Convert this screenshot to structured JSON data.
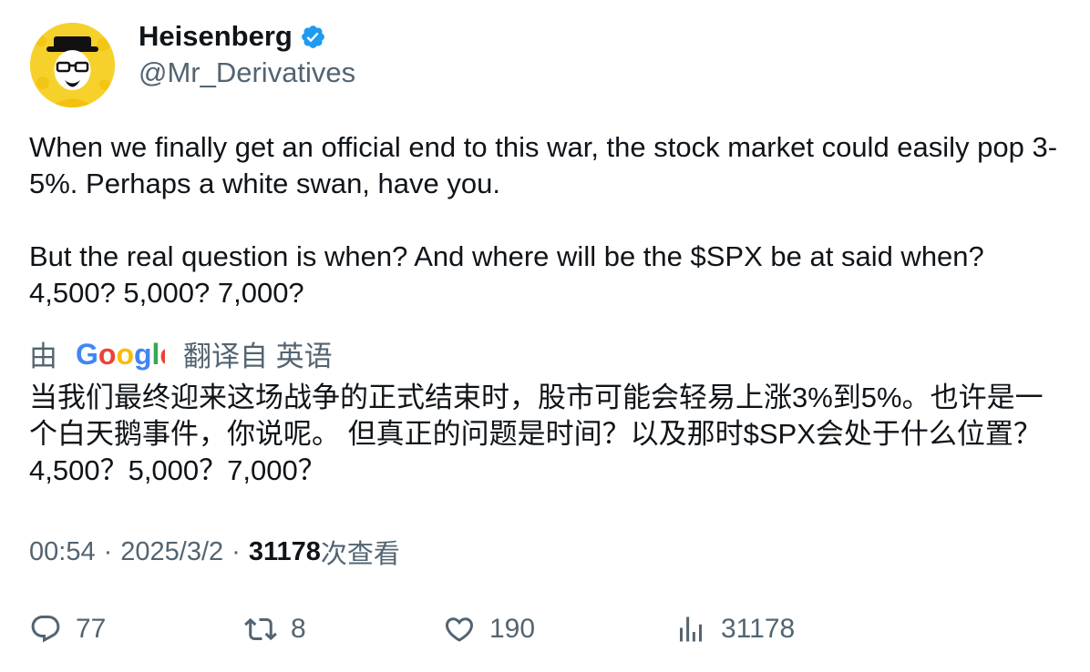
{
  "author": {
    "name": "Heisenberg",
    "handle": "@Mr_Derivatives",
    "verified_icon": "verified-badge-icon"
  },
  "tweet": {
    "text": "When we finally get an official end to this war, the stock market could easily pop 3-5%. Perhaps a white swan, have you.\n\nBut the real question is when? And where will be the $SPX be at said when? 4,500? 5,000? 7,000?"
  },
  "translation": {
    "prefix": "由",
    "provider": "Google",
    "suffix": "翻译自 英语",
    "text": "当我们最终迎来这场战争的正式结束时，股市可能会轻易上涨3%到5%。也许是一个白天鹅事件，你说呢。 但真正的问题是时间？以及那时$SPX会处于什么位置？4,500？5,000？7,000？"
  },
  "meta": {
    "time": "00:54",
    "separator": "·",
    "date": "2025/3/2",
    "views_count": "31178",
    "views_label": "次查看"
  },
  "actions": {
    "replies": "77",
    "retweets": "8",
    "likes": "190",
    "views": "31178"
  },
  "colors": {
    "text": "#0f1419",
    "secondary": "#536471",
    "verified": "#1d9bf0",
    "avatar_bg": "#f7d12b"
  }
}
